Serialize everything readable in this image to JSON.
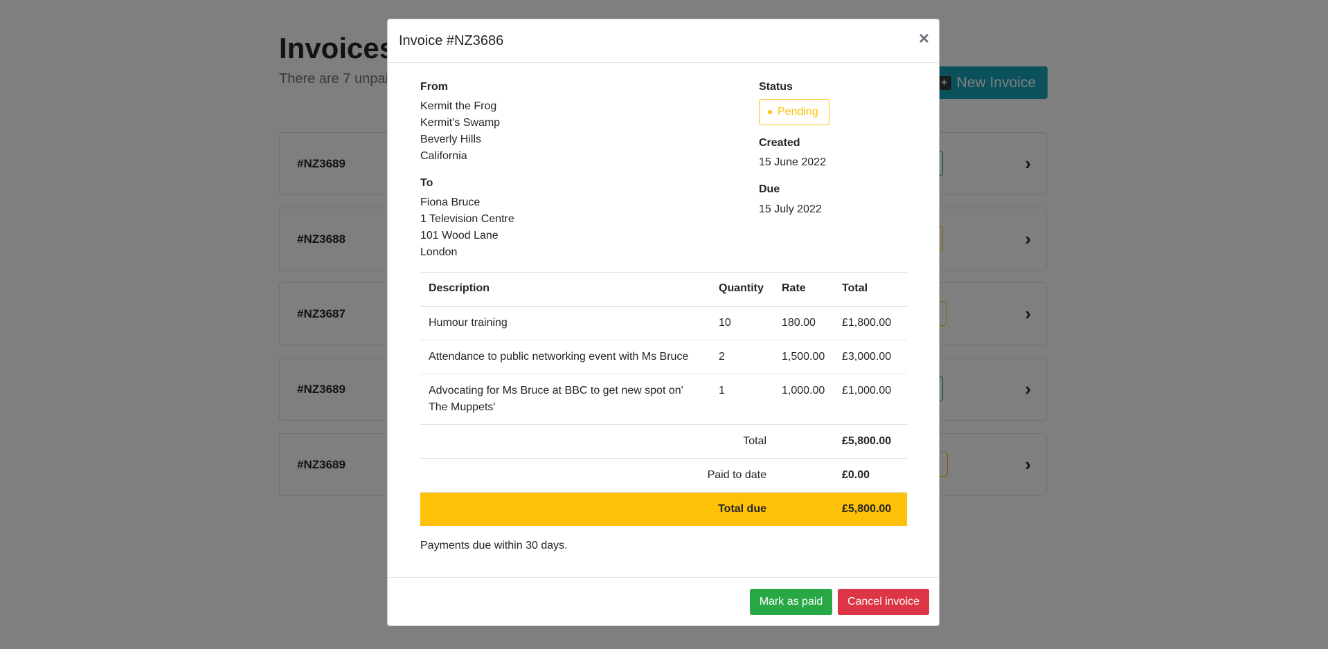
{
  "page": {
    "title": "Invoices",
    "subtitle": "There are 7 unpai",
    "new_invoice_label": "New Invoice",
    "new_invoice_icon": "plus-icon",
    "invoices": [
      {
        "number": "#NZ3689",
        "status_color": "#28a745"
      },
      {
        "number": "#NZ3688",
        "status_color": "#ffc107"
      },
      {
        "number": "#NZ3687",
        "status_color": "#ffc107"
      },
      {
        "number": "#NZ3689",
        "status_color": "#28a745"
      },
      {
        "number": "#NZ3689",
        "status_color": "#ffc107"
      }
    ]
  },
  "modal": {
    "title": "Invoice #NZ3686",
    "close_symbol": "×",
    "from": {
      "label": "From",
      "lines": [
        "Kermit the Frog",
        "Kermit's Swamp",
        "Beverly Hills",
        "California"
      ]
    },
    "to": {
      "label": "To",
      "lines": [
        "Fiona Bruce",
        "1 Television Centre",
        "101 Wood Lane",
        "London"
      ]
    },
    "status": {
      "label": "Status",
      "value": "Pending",
      "color": "#ffc107"
    },
    "created": {
      "label": "Created",
      "value": "15 June 2022"
    },
    "due": {
      "label": "Due",
      "value": "15 July 2022"
    },
    "table": {
      "headers": {
        "description": "Description",
        "quantity": "Quantity",
        "rate": "Rate",
        "total": "Total"
      },
      "rows": [
        {
          "description": "Humour training",
          "quantity": "10",
          "rate": "180.00",
          "total": "£1,800.00"
        },
        {
          "description": "Attendance to public networking event with Ms Bruce",
          "quantity": "2",
          "rate": "1,500.00",
          "total": "£3,000.00"
        },
        {
          "description": "Advocating for Ms Bruce at BBC to get new spot on' The Muppets'",
          "quantity": "1",
          "rate": "1,000.00",
          "total": "£1,000.00"
        }
      ],
      "summary": {
        "total_label": "Total",
        "total_value": "£5,800.00",
        "paid_label": "Paid to date",
        "paid_value": "£0.00",
        "due_label": "Total due",
        "due_value": "£5,800.00"
      }
    },
    "note": "Payments due within 30 days.",
    "buttons": {
      "mark_paid": "Mark as paid",
      "cancel": "Cancel invoice"
    },
    "colors": {
      "accent": "#17a2b8",
      "success": "#28a745",
      "danger": "#dc3545",
      "warning": "#ffc107"
    }
  }
}
